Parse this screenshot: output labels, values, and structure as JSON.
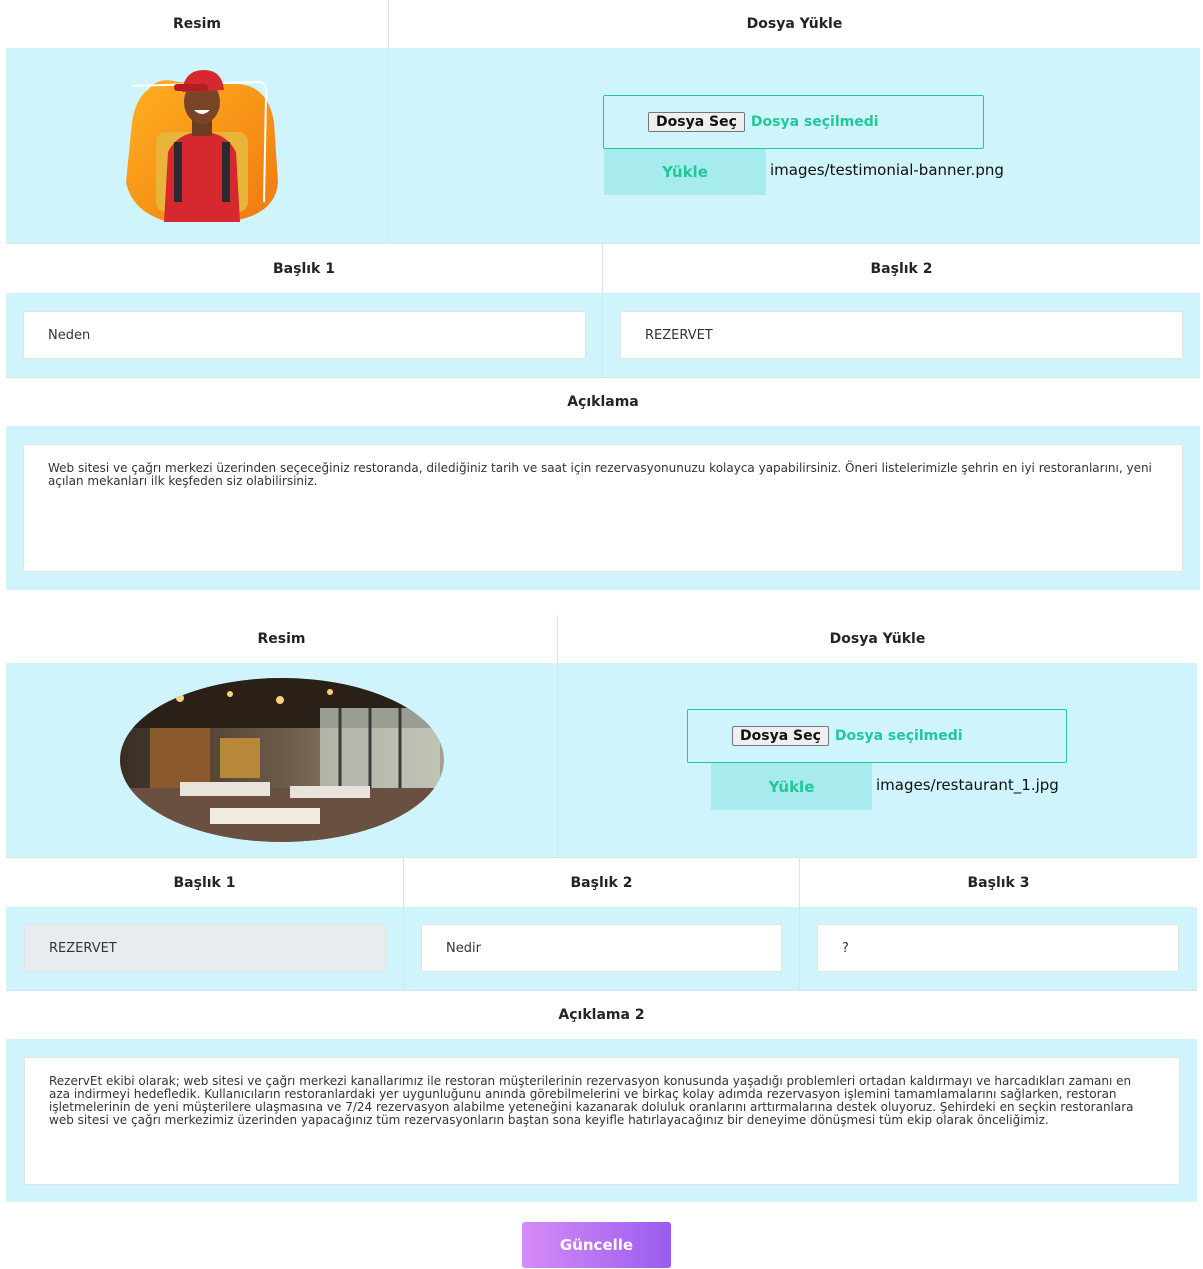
{
  "section1": {
    "image_header": "Resim",
    "upload_header": "Dosya Yükle",
    "image_alt": "delivery person with backpack",
    "file_button": "Dosya Seç",
    "file_status": "Dosya seçilmedi",
    "upload_button": "Yükle",
    "file_path": "images/testimonial-banner.png",
    "title1_header": "Başlık 1",
    "title2_header": "Başlık 2",
    "title1_value": "Neden",
    "title2_value": "REZERVET",
    "description_header": "Açıklama",
    "description_value": "Web sitesi ve çağrı merkezi üzerinden seçeceğiniz restoranda, dilediğiniz tarih ve saat için rezervasyonunuzu kolayca yapabilirsiniz. Öneri listelerimizle şehrin en iyi restoranlarını, yeni açılan mekanları ilk keşfeden siz olabilirsiniz."
  },
  "section2": {
    "image_header": "Resim",
    "upload_header": "Dosya Yükle",
    "image_alt": "restaurant interior",
    "file_button": "Dosya Seç",
    "file_status": "Dosya seçilmedi",
    "upload_button": "Yükle",
    "file_path": "images/restaurant_1.jpg",
    "title1_header": "Başlık 1",
    "title2_header": "Başlık 2",
    "title3_header": "Başlık 3",
    "title1_value": "REZERVET",
    "title2_value": "Nedir",
    "title3_value": "?",
    "description_header": "Açıklama 2",
    "description_value": "RezervEt ekibi olarak; web sitesi ve çağrı merkezi kanallarımız ile restoran müşterilerinin rezervasyon konusunda yaşadığı problemleri ortadan kaldırmayı ve harcadıkları zamanı en aza indirmeyi hedefledik. Kullanıcıların restoranlardaki yer uygunluğunu anında görebilmelerini ve birkaç kolay adımda rezervasyon işlemini tamamlamalarını sağlarken, restoran işletmelerinin de yeni müşterilere ulaşmasına ve 7/24 rezervasyon alabilme yeteneğini kazanarak doluluk oranlarını arttırmalarına destek oluyoruz. Şehirdeki en seçkin restoranlara web sitesi ve çağrı merkezimiz üzerinden yapacağınız tüm rezervasyonların baştan sona keyifle hatırlayacağınız bir deneyime dönüşmesi tüm ekip olarak önceliğimiz."
  },
  "submit_button": "Güncelle",
  "colors": {
    "cell_background": "#cff4fc",
    "accent": "#20c997",
    "upload_button": "#a8ebef",
    "submit_gradient_start": "#d58cf7",
    "submit_gradient_end": "#9a5cf0"
  }
}
